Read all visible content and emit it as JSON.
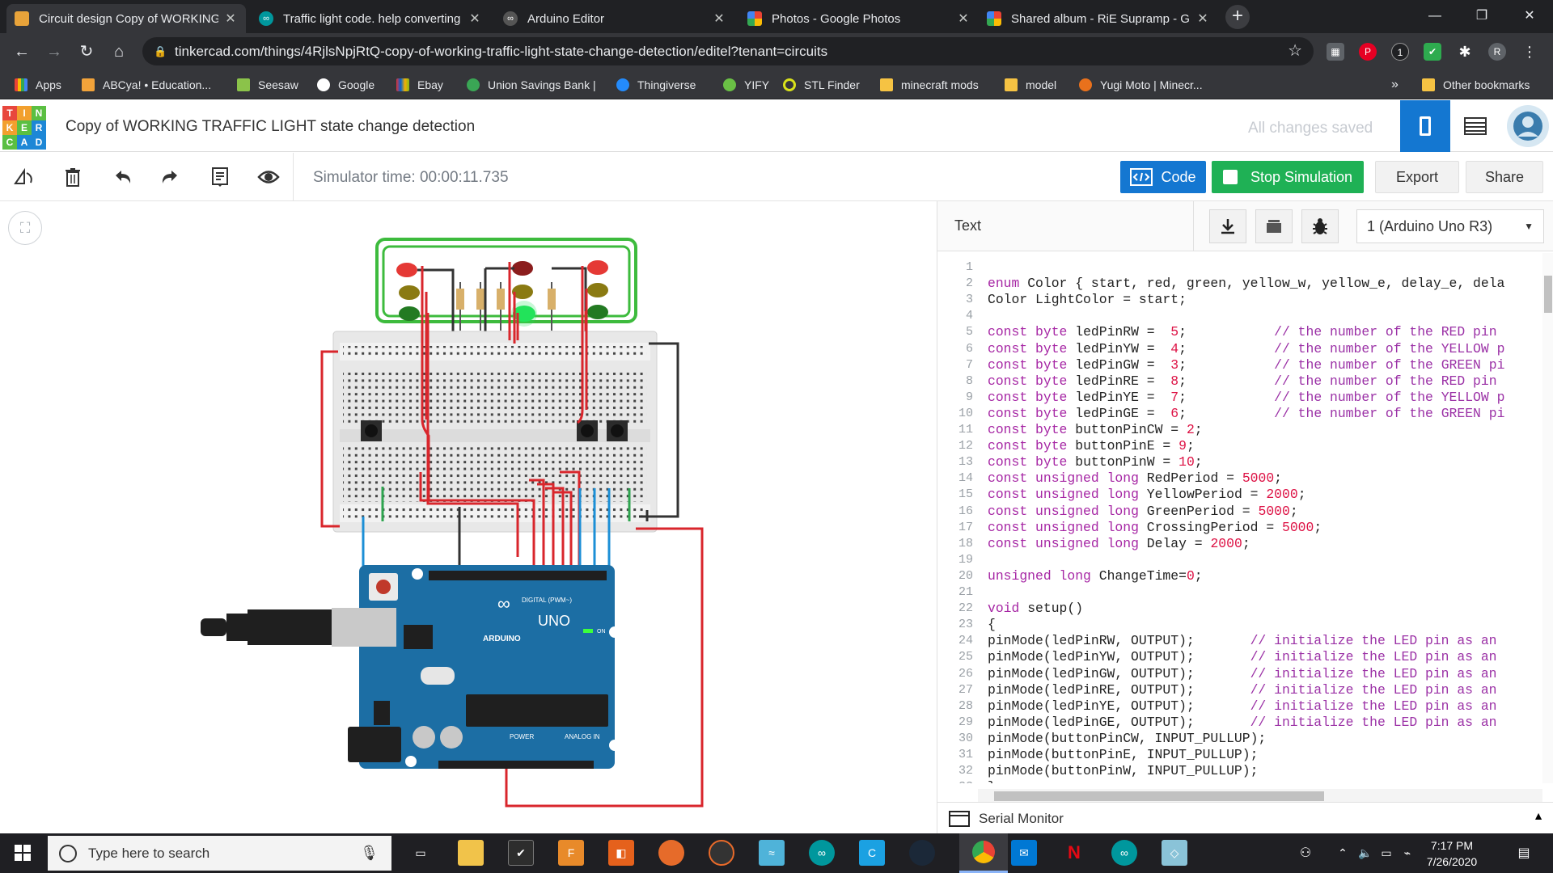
{
  "browser": {
    "tabs": [
      {
        "title": "Circuit design Copy of WORKING",
        "active": true
      },
      {
        "title": "Traffic light code. help converting",
        "active": false
      },
      {
        "title": "Arduino Editor",
        "active": false
      },
      {
        "title": "Photos - Google Photos",
        "active": false
      },
      {
        "title": "Shared album - RiE Supramp - G",
        "active": false
      }
    ],
    "url": "tinkercad.com/things/4RjlsNpjRtQ-copy-of-working-traffic-light-state-change-detection/editel?tenant=circuits",
    "bookmarks": [
      "Apps",
      "ABCya! • Education...",
      "Seesaw",
      "Google",
      "Ebay",
      "Union Savings Bank |",
      "Thingiverse",
      "YIFY",
      "STL Finder",
      "minecraft mods",
      "model",
      "Yugi Moto | Minecr..."
    ],
    "other_bookmarks": "Other bookmarks",
    "overflow": "»",
    "profile_initial": "R"
  },
  "tinkercad": {
    "logo_letters": [
      "T",
      "I",
      "N",
      "K",
      "E",
      "R",
      "C",
      "A",
      "D"
    ],
    "project_title": "Copy of WORKING TRAFFIC LIGHT state change detection",
    "save_status": "All changes saved"
  },
  "toolbar": {
    "simulator_time": "Simulator time: 00:00:11.735",
    "code_label": "Code",
    "stop_label": "Stop Simulation",
    "export_label": "Export",
    "share_label": "Share"
  },
  "code_panel": {
    "mode_label": "Text",
    "device": "1 (Arduino Uno R3)",
    "serial_monitor": "Serial Monitor",
    "lines": [
      "",
      "enum Color { start, red, green, yellow_w, yellow_e, delay_e, dela",
      "Color LightColor = start;",
      "",
      "const byte ledPinRW =  5;           // the number of the RED pin",
      "const byte ledPinYW =  4;           // the number of the YELLOW p",
      "const byte ledPinGW =  3;           // the number of the GREEN pi",
      "const byte ledPinRE =  8;           // the number of the RED pin",
      "const byte ledPinYE =  7;           // the number of the YELLOW p",
      "const byte ledPinGE =  6;           // the number of the GREEN pi",
      "const byte buttonPinCW = 2;",
      "const byte buttonPinE = 9;",
      "const byte buttonPinW = 10;",
      "const unsigned long RedPeriod = 5000;",
      "const unsigned long YellowPeriod = 2000;",
      "const unsigned long GreenPeriod = 5000;",
      "const unsigned long CrossingPeriod = 5000;",
      "const unsigned long Delay = 2000;",
      "",
      "unsigned long ChangeTime=0;",
      "",
      "void setup()",
      "{",
      "pinMode(ledPinRW, OUTPUT);       // initialize the LED pin as an",
      "pinMode(ledPinYW, OUTPUT);       // initialize the LED pin as an",
      "pinMode(ledPinGW, OUTPUT);       // initialize the LED pin as an",
      "pinMode(ledPinRE, OUTPUT);       // initialize the LED pin as an",
      "pinMode(ledPinYE, OUTPUT);       // initialize the LED pin as an",
      "pinMode(ledPinGE, OUTPUT);       // initialize the LED pin as an",
      "pinMode(buttonPinCW, INPUT_PULLUP);",
      "pinMode(buttonPinE, INPUT_PULLUP);",
      "pinMode(buttonPinW, INPUT_PULLUP);",
      "}",
      ""
    ]
  },
  "arduino": {
    "brand": "ARDUINO",
    "model": "UNO",
    "power": "POWER",
    "analog": "ANALOG IN",
    "digital": "DIGITAL (PWM~)",
    "on": "ON"
  },
  "taskbar": {
    "search_placeholder": "Type here to search",
    "time": "7:17 PM",
    "date": "7/26/2020"
  },
  "colors": {
    "accent_blue": "#1477d1",
    "stop_green": "#1fb155",
    "board_blue": "#1c6ea4",
    "wire_red": "#d9262c",
    "wire_blue": "#1c8fd6",
    "led_green_on": "#22e35a"
  }
}
